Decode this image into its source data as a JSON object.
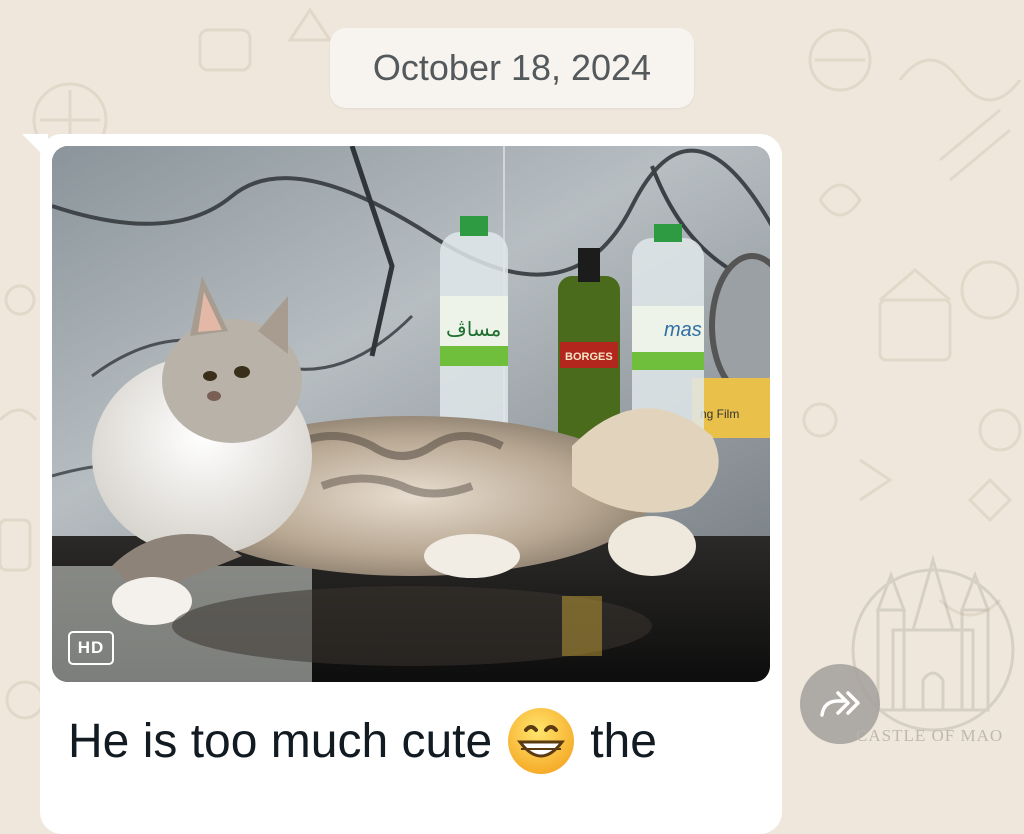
{
  "date_separator": "October 18, 2024",
  "message": {
    "media_badge": "HD",
    "caption_before": "He is too much cute",
    "emoji": "grinning-face",
    "caption_after": "the",
    "photo_labels": {
      "bottle_left_arabic": "مساڤ",
      "bottle_right_brand": "mas",
      "oil_bottle_brand": "BORGES",
      "package_text": "ng Film"
    }
  },
  "forward_icon": "forward-icon",
  "watermark_text": "CASTLE OF MAO",
  "colors": {
    "wallpaper": "#efe7dc",
    "bubble": "#ffffff",
    "date_chip": "#f7f4f0",
    "date_text": "#54595c",
    "caption_text": "#111b21"
  }
}
